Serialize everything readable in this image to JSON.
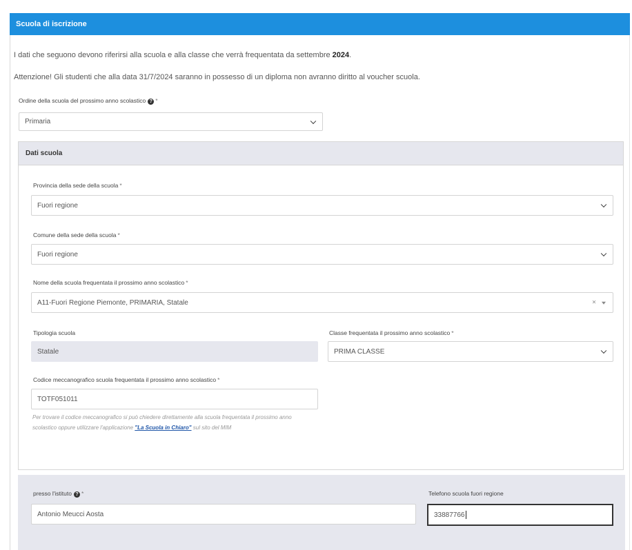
{
  "section": {
    "title": "Scuola di iscrizione"
  },
  "intro": {
    "line1_prefix": "I dati che seguono devono riferirsi alla scuola e alla classe che verrà frequentata da settembre ",
    "line1_year": "2024",
    "line1_suffix": ".",
    "line2": "Attenzione! Gli studenti che alla data 31/7/2024 saranno in possesso di un diploma non avranno diritto al voucher scuola."
  },
  "ordine": {
    "label": "Ordine della scuola del prossimo anno scolastico",
    "required_mark": "*",
    "value": "Primaria"
  },
  "dati_scuola": {
    "title": "Dati scuola",
    "provincia": {
      "label": "Provincia della sede della scuola",
      "required_mark": "*",
      "value": "Fuori regione"
    },
    "comune": {
      "label": "Comune della sede della scuola",
      "required_mark": "*",
      "value": "Fuori regione"
    },
    "nome_scuola": {
      "label": "Nome della scuola frequentata il prossimo anno scolastico",
      "required_mark": "*",
      "value": "A11-Fuori Regione Piemonte, PRIMARIA, Statale",
      "clear_symbol": "×"
    },
    "tipologia": {
      "label": "Tipologia scuola",
      "value": "Statale"
    },
    "classe": {
      "label": "Classe frequentata il prossimo anno scolastico",
      "required_mark": "*",
      "value": "PRIMA CLASSE"
    },
    "codice": {
      "label": "Codice meccanografico scuola frequentata il prossimo anno scolastico",
      "required_mark": "*",
      "value": "TOTF051011",
      "help_prefix": "Per trovare il codice meccanografico si può chiedere direttamente alla scuola frequentata il prossimo anno scolastico oppure utilizzare l'applicazione ",
      "help_link": "\"La Scuola in Chiaro\"",
      "help_suffix": " sul sito del MIM"
    }
  },
  "istituto": {
    "presso": {
      "label": "presso l'istituto",
      "required_mark": "*",
      "value": "Antonio Meucci Aosta"
    },
    "telefono": {
      "label": "Telefono scuola fuori regione",
      "value": "33887766"
    }
  },
  "icons": [
    "question-circle-icon",
    "chevron-down-icon",
    "clear-icon",
    "caret-down-icon"
  ]
}
